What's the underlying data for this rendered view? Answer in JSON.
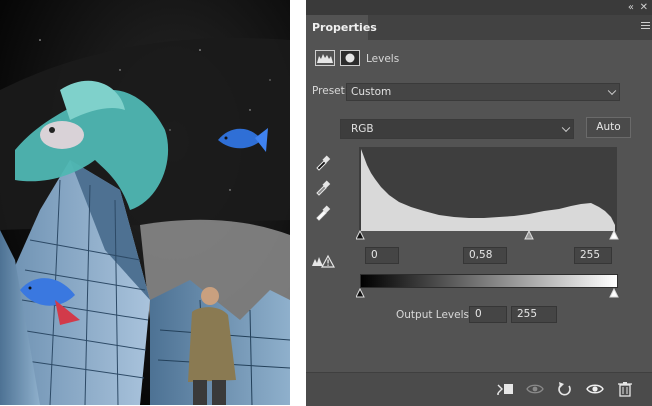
{
  "document": {
    "sky_color": "#050505",
    "scene": "collage"
  },
  "panel": {
    "title": "Properties",
    "adjustment_name": "Levels",
    "preset_label": "Preset:",
    "preset_value": "Custom",
    "channel_value": "RGB",
    "auto_label": "Auto",
    "input_black": "0",
    "input_gamma": "0,58",
    "input_white": "255",
    "output_label": "Output Levels:",
    "output_black": "0",
    "output_white": "255"
  },
  "histogram": {
    "type": "area",
    "x_range": [
      0,
      255
    ],
    "fill": "#d9d9d9",
    "background": "#3e3e3e"
  },
  "colors": {
    "panel_bg": "#535353",
    "dark_bar": "#3a3a3a",
    "text": "#dcdcdc"
  }
}
